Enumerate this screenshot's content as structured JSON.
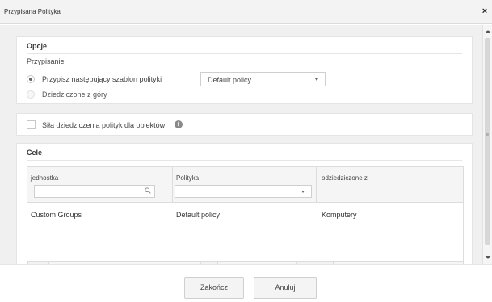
{
  "window": {
    "title": "Przypisana Polityka",
    "close_label": "×"
  },
  "opcje": {
    "title": "Opcje",
    "assignment_label": "Przypisanie",
    "options": [
      {
        "label": "Przypisz następujący szablon polityki",
        "selected": true,
        "enabled": true
      },
      {
        "label": "Dziedziczone z góry",
        "selected": false,
        "enabled": false
      }
    ],
    "policy_select": {
      "value": "Default policy"
    }
  },
  "inheritance": {
    "checkbox_label": "Siła dziedziczenia polityk dla obiektów",
    "checked": false,
    "info_icon": "info-icon"
  },
  "cele": {
    "title": "Cele",
    "columns": [
      {
        "header": "jednostka",
        "filter": "search-input"
      },
      {
        "header": "Polityka",
        "filter": "select"
      },
      {
        "header": "odziedziczone z",
        "filter": "none"
      }
    ],
    "rows": [
      {
        "unit": "Custom Groups",
        "policy": "Default policy",
        "inherited_from": "Komputery"
      }
    ]
  },
  "footer": {
    "finish_label": "Zakończ",
    "cancel_label": "Anuluj"
  }
}
